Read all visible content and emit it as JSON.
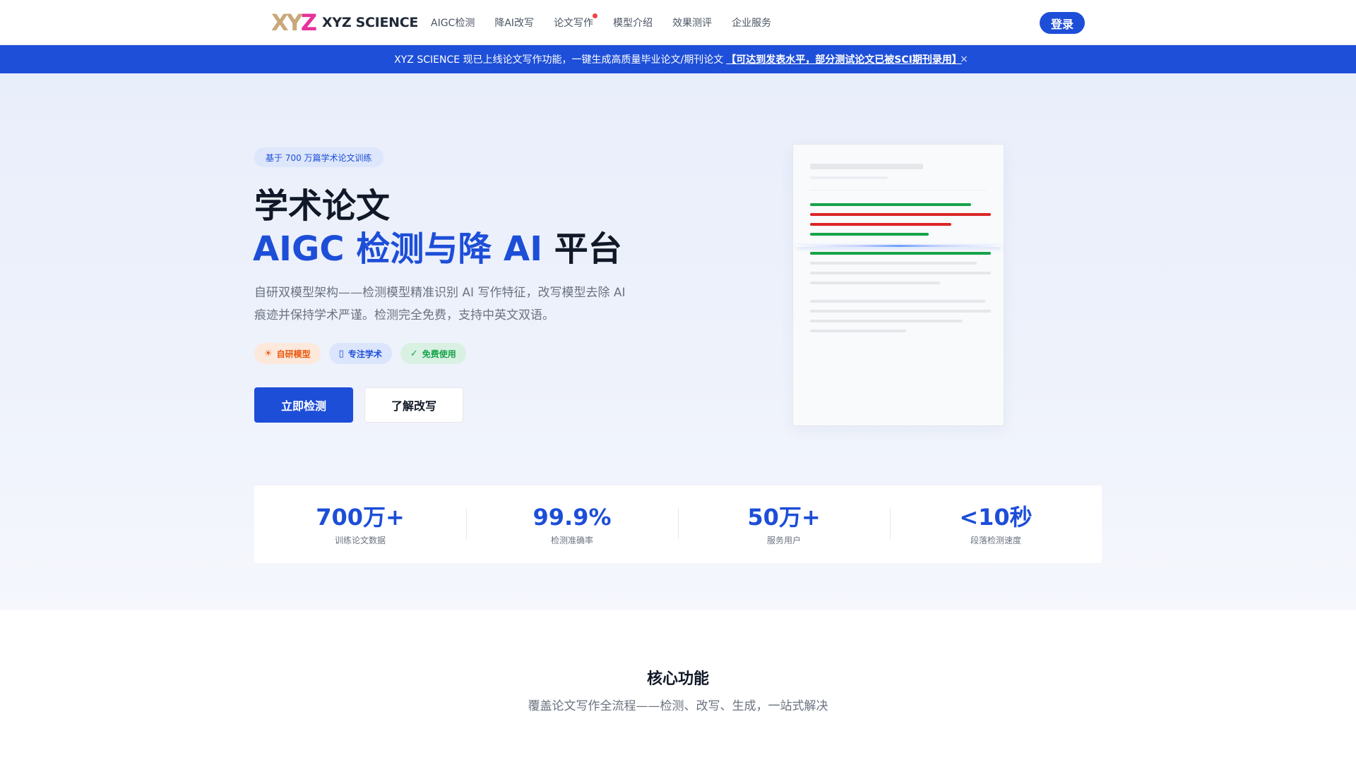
{
  "header": {
    "logo_mark": {
      "x": "X",
      "y": "Y",
      "z": "Z"
    },
    "brand": "XYZ SCIENCE",
    "nav": [
      {
        "label": "AIGC检测",
        "badge": false
      },
      {
        "label": "降AI改写",
        "badge": false
      },
      {
        "label": "论文写作",
        "badge": true
      },
      {
        "label": "模型介绍",
        "badge": false
      },
      {
        "label": "效果测评",
        "badge": false
      },
      {
        "label": "企业服务",
        "badge": false
      }
    ],
    "login_label": "登录"
  },
  "announcement": {
    "text": "XYZ SCIENCE 现已上线论文写作功能，一键生成高质量毕业论文/期刊论文",
    "link": "【可达到发表水平，部分测试论文已被SCI期刊录用】",
    "close_icon": "×"
  },
  "hero": {
    "tag": "基于 700 万篇学术论文训练",
    "title_line1": "学术论文",
    "title_line2_blue": "AIGC 检测与降 AI",
    "title_line2_dark": "平台",
    "description": "自研双模型架构——检测模型精准识别 AI 写作特征，改写模型去除 AI 痕迹并保持学术严谨。检测完全免费，支持中英文双语。",
    "chips": [
      {
        "icon": "☀",
        "label": "自研模型"
      },
      {
        "icon": "▯",
        "label": "专注学术"
      },
      {
        "icon": "✓",
        "label": "免费使用"
      }
    ],
    "primary_button": "立即检测",
    "secondary_button": "了解改写"
  },
  "colors": {
    "accent": "#1d4ed8",
    "ai_red": "#dc2626",
    "human_green": "#16a34a"
  },
  "stats": [
    {
      "value": "700万+",
      "label": "训练论文数据"
    },
    {
      "value": "99.9%",
      "label": "检测准确率"
    },
    {
      "value": "50万+",
      "label": "服务用户"
    },
    {
      "value": "<10秒",
      "label": "段落检测速度"
    }
  ],
  "features": {
    "title": "核心功能",
    "subtitle": "覆盖论文写作全流程——检测、改写、生成，一站式解决"
  }
}
